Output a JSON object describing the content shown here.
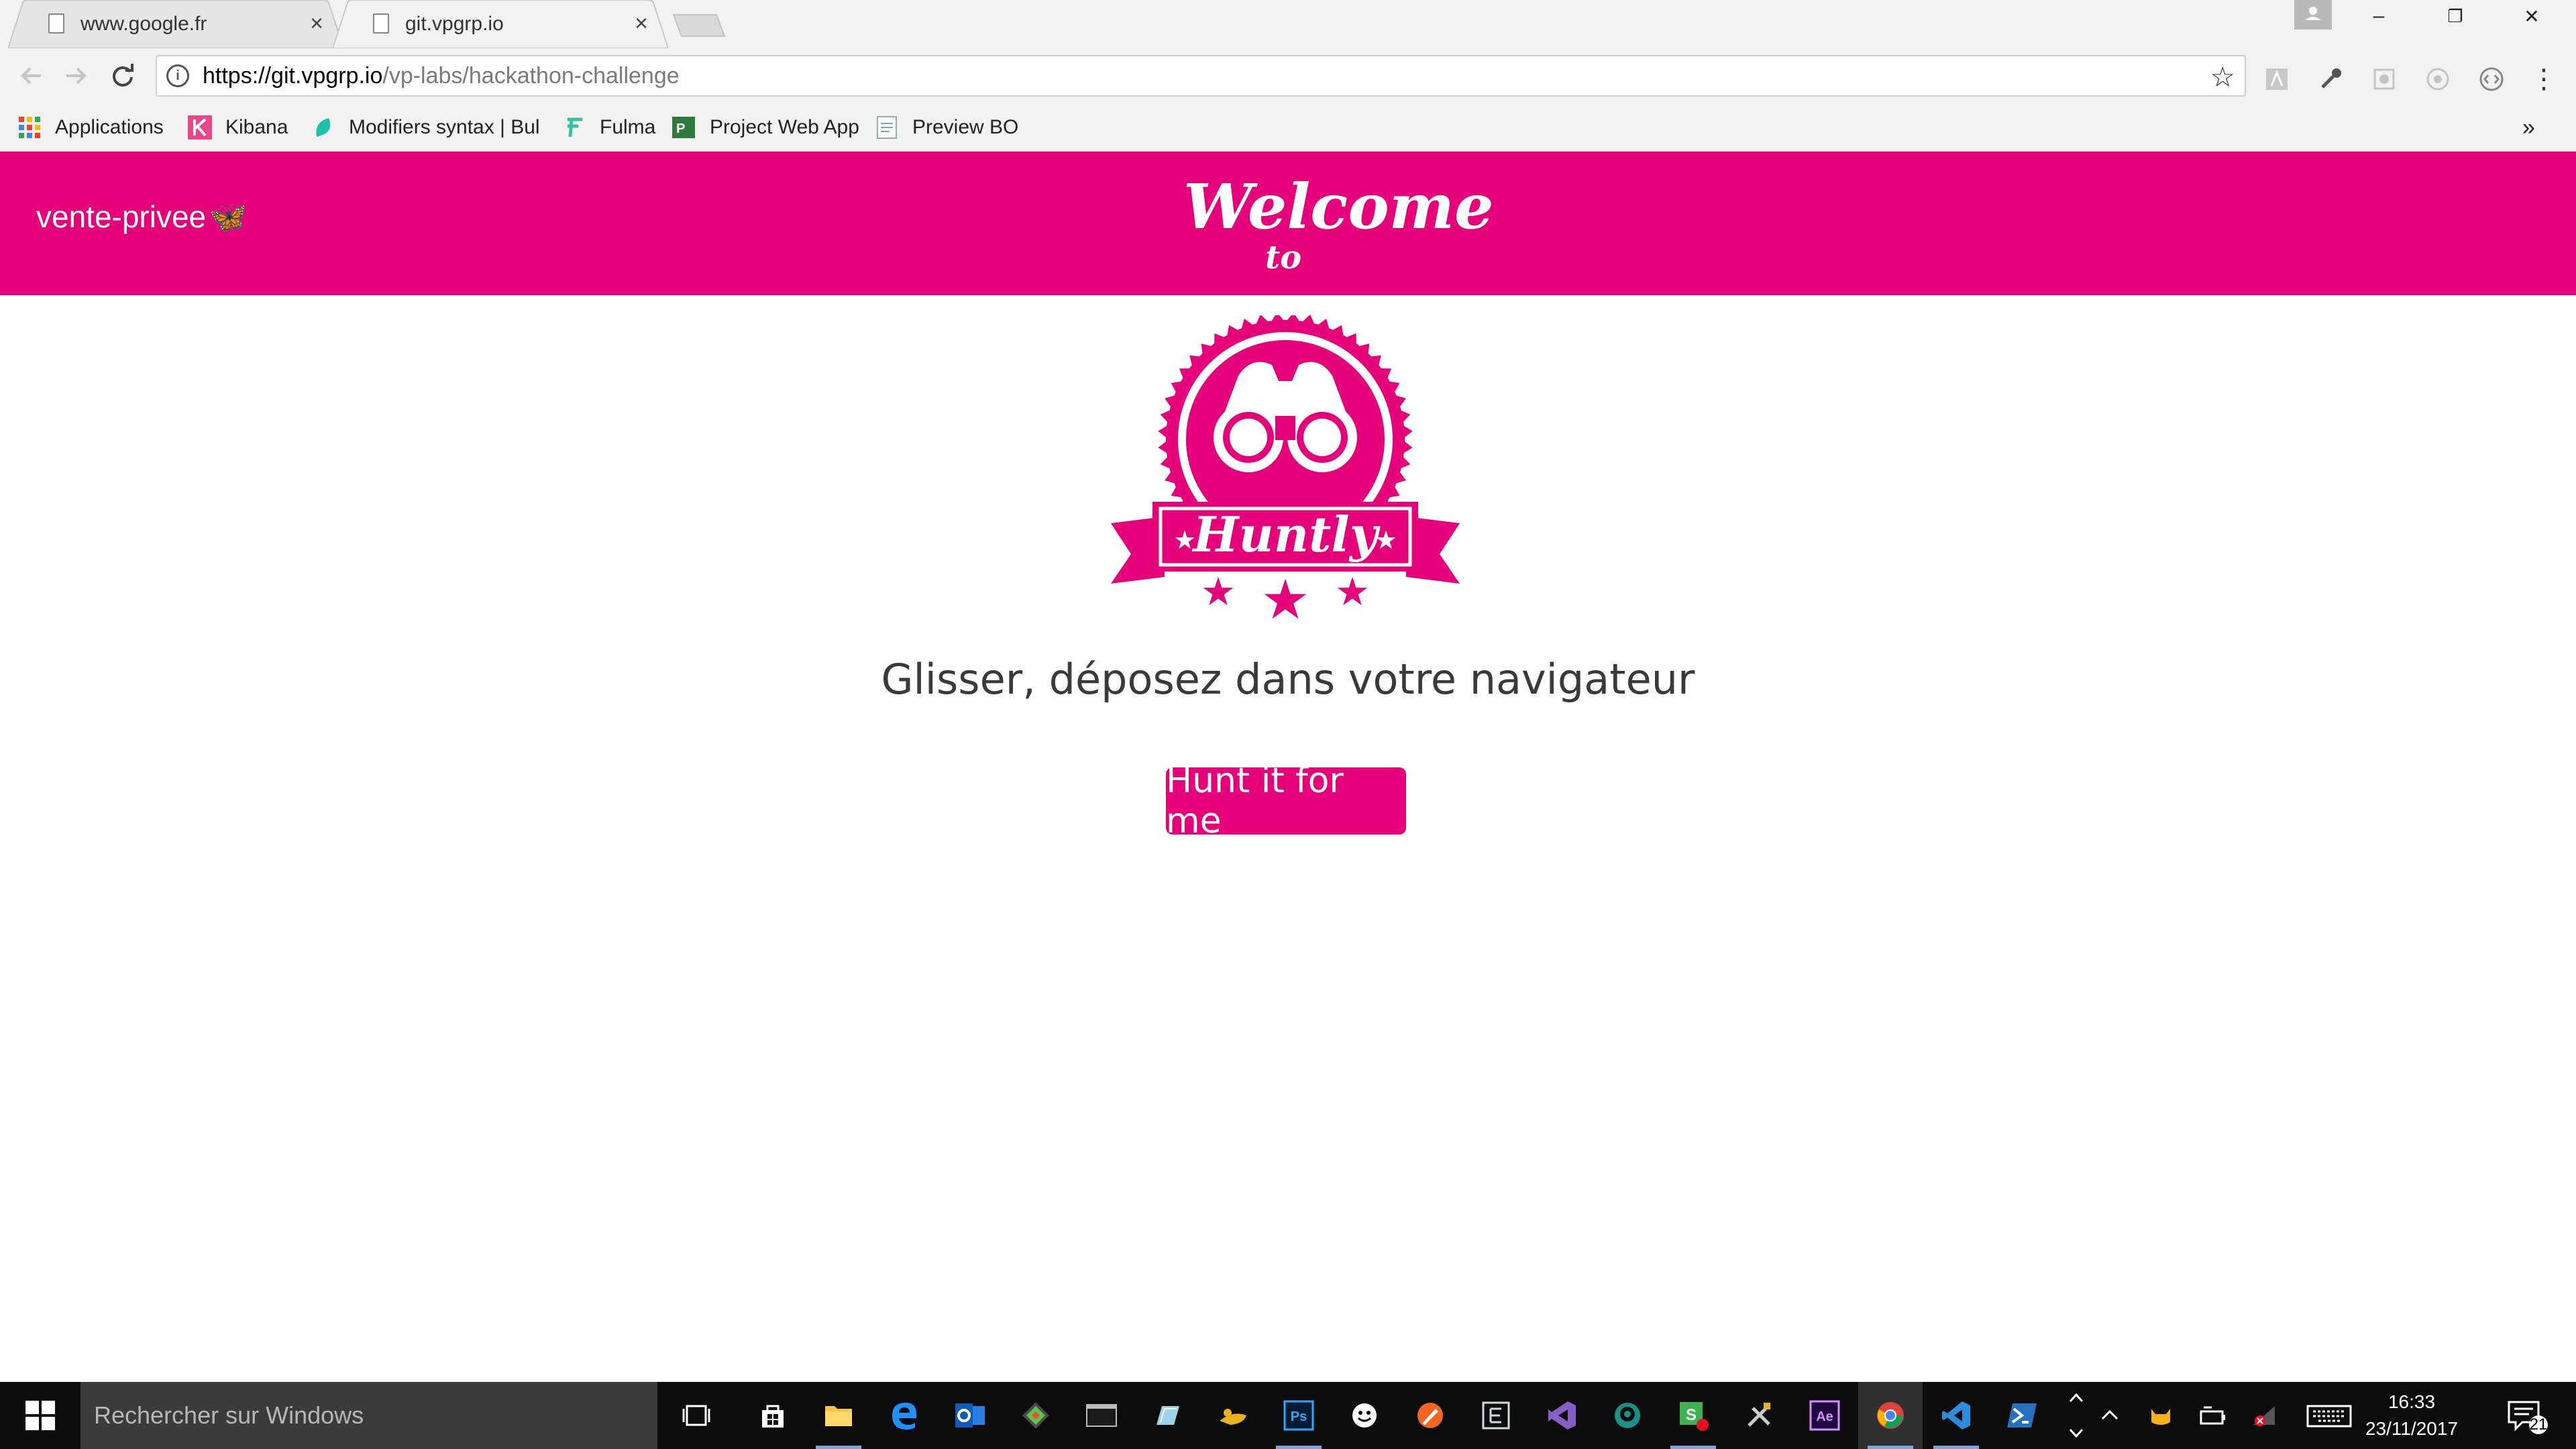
{
  "browser": {
    "tabs": [
      {
        "title": "www.google.fr",
        "close": "×"
      },
      {
        "title": "git.vpgrp.io",
        "close": "×"
      }
    ],
    "window_controls": {
      "minimize": "–",
      "restore": "❐",
      "close": "✕"
    },
    "address": {
      "url_host": "https://git.vpgrp.io",
      "url_path": "/vp-labs/hackathon-challenge"
    },
    "bookmarks": [
      {
        "label": "Applications"
      },
      {
        "label": "Kibana"
      },
      {
        "label": "Modifiers syntax | Bul"
      },
      {
        "label": "Fulma"
      },
      {
        "label": "Project Web App"
      },
      {
        "label": "Preview BO"
      }
    ],
    "bookmarks_overflow": "»"
  },
  "page": {
    "brand": "vente-privee",
    "welcome": "Welcome",
    "welcome_to": "to",
    "logo_text": "Huntly",
    "tagline": "Glisser, déposez dans votre navigateur",
    "cta_label": "Hunt it for me",
    "accent_color": "#e4017a"
  },
  "taskbar": {
    "search_placeholder": "Rechercher sur Windows",
    "time": "16:33",
    "date": "23/11/2017",
    "notification_count": "21",
    "apps": [
      {
        "icon": "task-view-icon"
      },
      {
        "icon": "store-icon"
      },
      {
        "icon": "file-explorer-icon"
      },
      {
        "icon": "edge-icon"
      },
      {
        "icon": "outlook-icon"
      },
      {
        "icon": "git-icon"
      },
      {
        "icon": "terminal-icon"
      },
      {
        "icon": "notes-icon"
      },
      {
        "icon": "lamp-icon"
      },
      {
        "icon": "photoshop-icon",
        "label": "Ps"
      },
      {
        "icon": "smiley-icon"
      },
      {
        "icon": "paint-icon"
      },
      {
        "icon": "editor-icon"
      },
      {
        "icon": "visual-studio-icon"
      },
      {
        "icon": "gitkraken-icon"
      },
      {
        "icon": "skype-business-icon"
      },
      {
        "icon": "tools-icon"
      },
      {
        "icon": "after-effects-icon",
        "label": "Ae"
      },
      {
        "icon": "chrome-icon"
      },
      {
        "icon": "vscode-icon"
      },
      {
        "icon": "powershell-icon"
      }
    ]
  }
}
